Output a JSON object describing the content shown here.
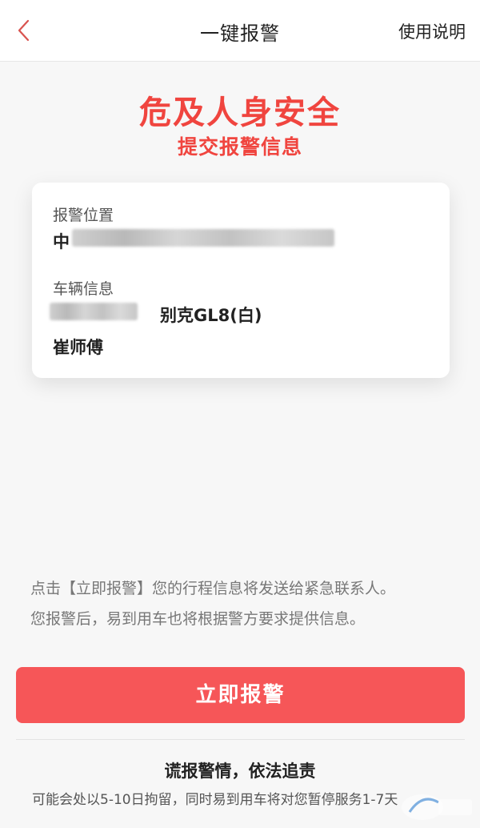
{
  "header": {
    "title": "一键报警",
    "help_link": "使用说明",
    "back_icon": "chevron-left-icon"
  },
  "headline": {
    "title": "危及人身安全",
    "subtitle": "提交报警信息"
  },
  "card": {
    "location_label": "报警位置",
    "location_value_prefix": "中",
    "vehicle_label": "车辆信息",
    "vehicle_model": "别克GL8(白)",
    "driver_name": "崔师傅"
  },
  "notice": {
    "line1": "点击【立即报警】您的行程信息将发送给紧急联系人。",
    "line2": "您报警后，易到用车也将根据警方要求提供信息。"
  },
  "alarm_button": {
    "label": "立即报警"
  },
  "warning": {
    "title": "谎报警情，依法追责",
    "text": "可能会处以5-10日拘留，同时易到用车将对您暂停服务1-7天"
  },
  "colors": {
    "accent_red": "#f0453f",
    "button_red": "#f65658",
    "back_icon": "#d9534f"
  }
}
